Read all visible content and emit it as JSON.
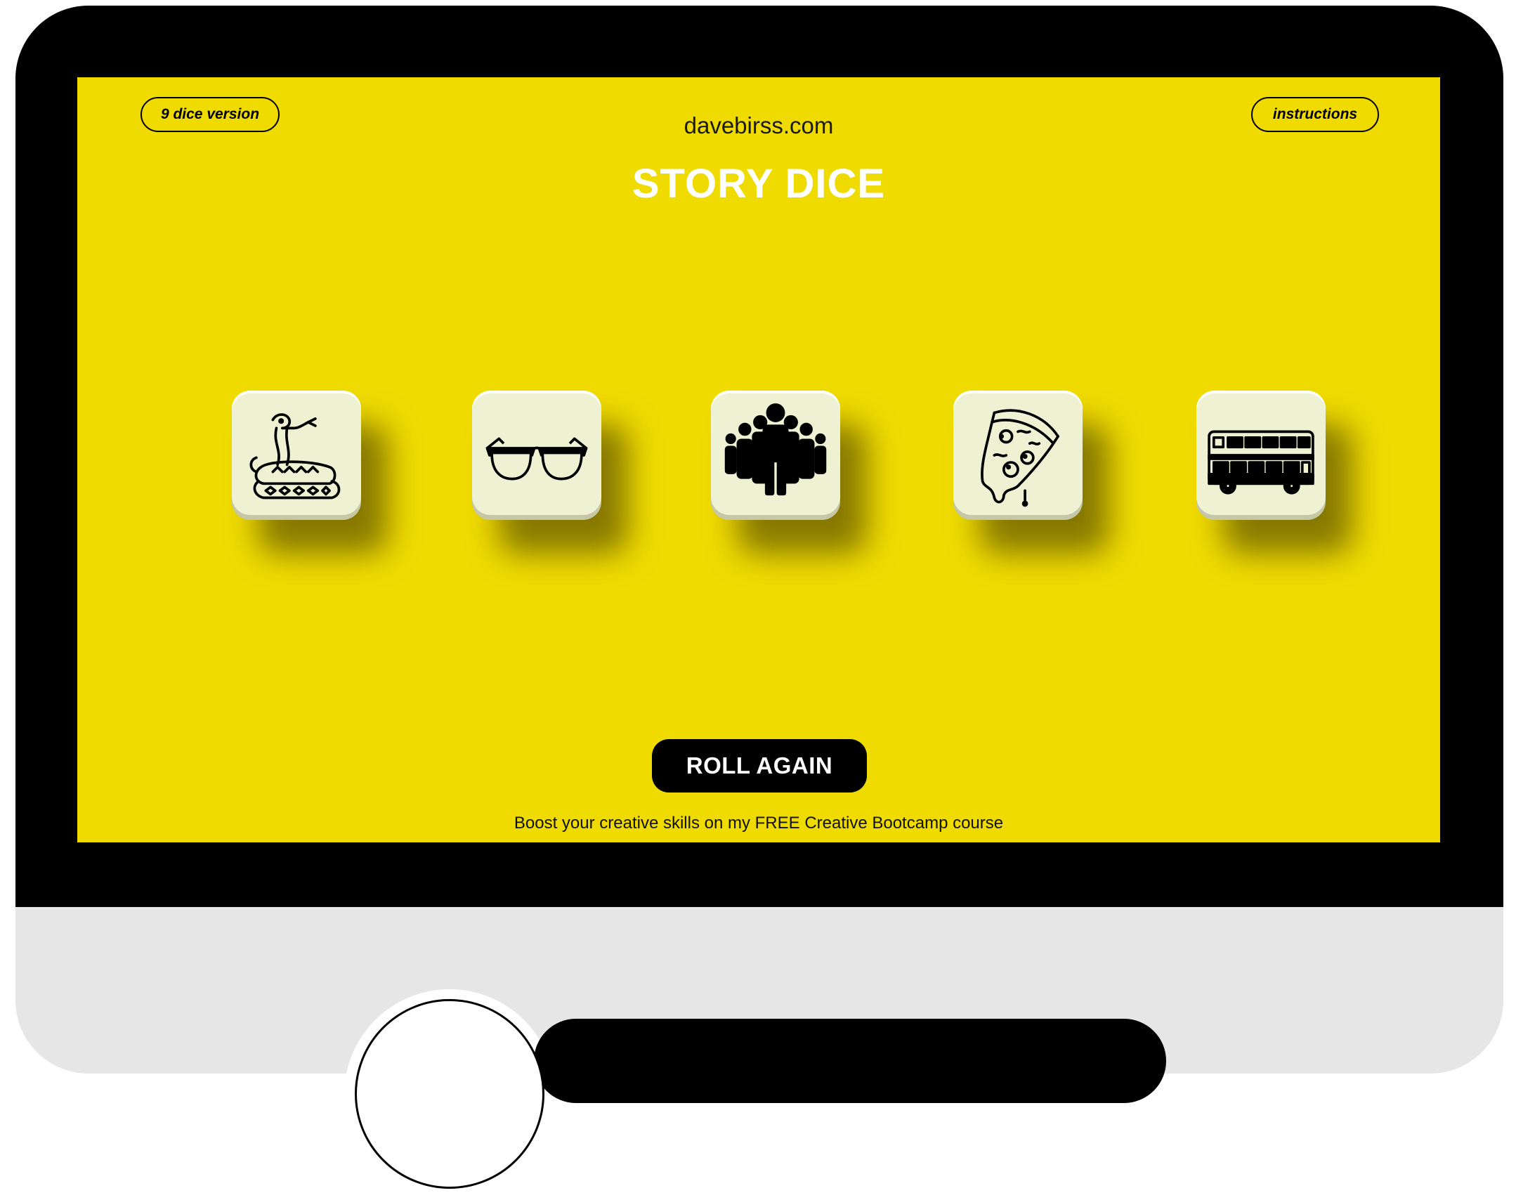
{
  "header": {
    "left_button": "9 dice version",
    "right_button": "instructions",
    "site": "davebirss.com",
    "title": "STORY DICE"
  },
  "dice": [
    {
      "icon": "snake-icon"
    },
    {
      "icon": "glasses-icon"
    },
    {
      "icon": "crowd-icon"
    },
    {
      "icon": "pizza-slice-icon"
    },
    {
      "icon": "double-decker-bus-icon"
    }
  ],
  "roll_button": "ROLL AGAIN",
  "promo": "Boost your creative skills on my FREE Creative Bootcamp course",
  "colors": {
    "screen_background": "#f0db00",
    "die_face": "#eef1d2",
    "button": "#000000",
    "title": "#ffffff"
  }
}
